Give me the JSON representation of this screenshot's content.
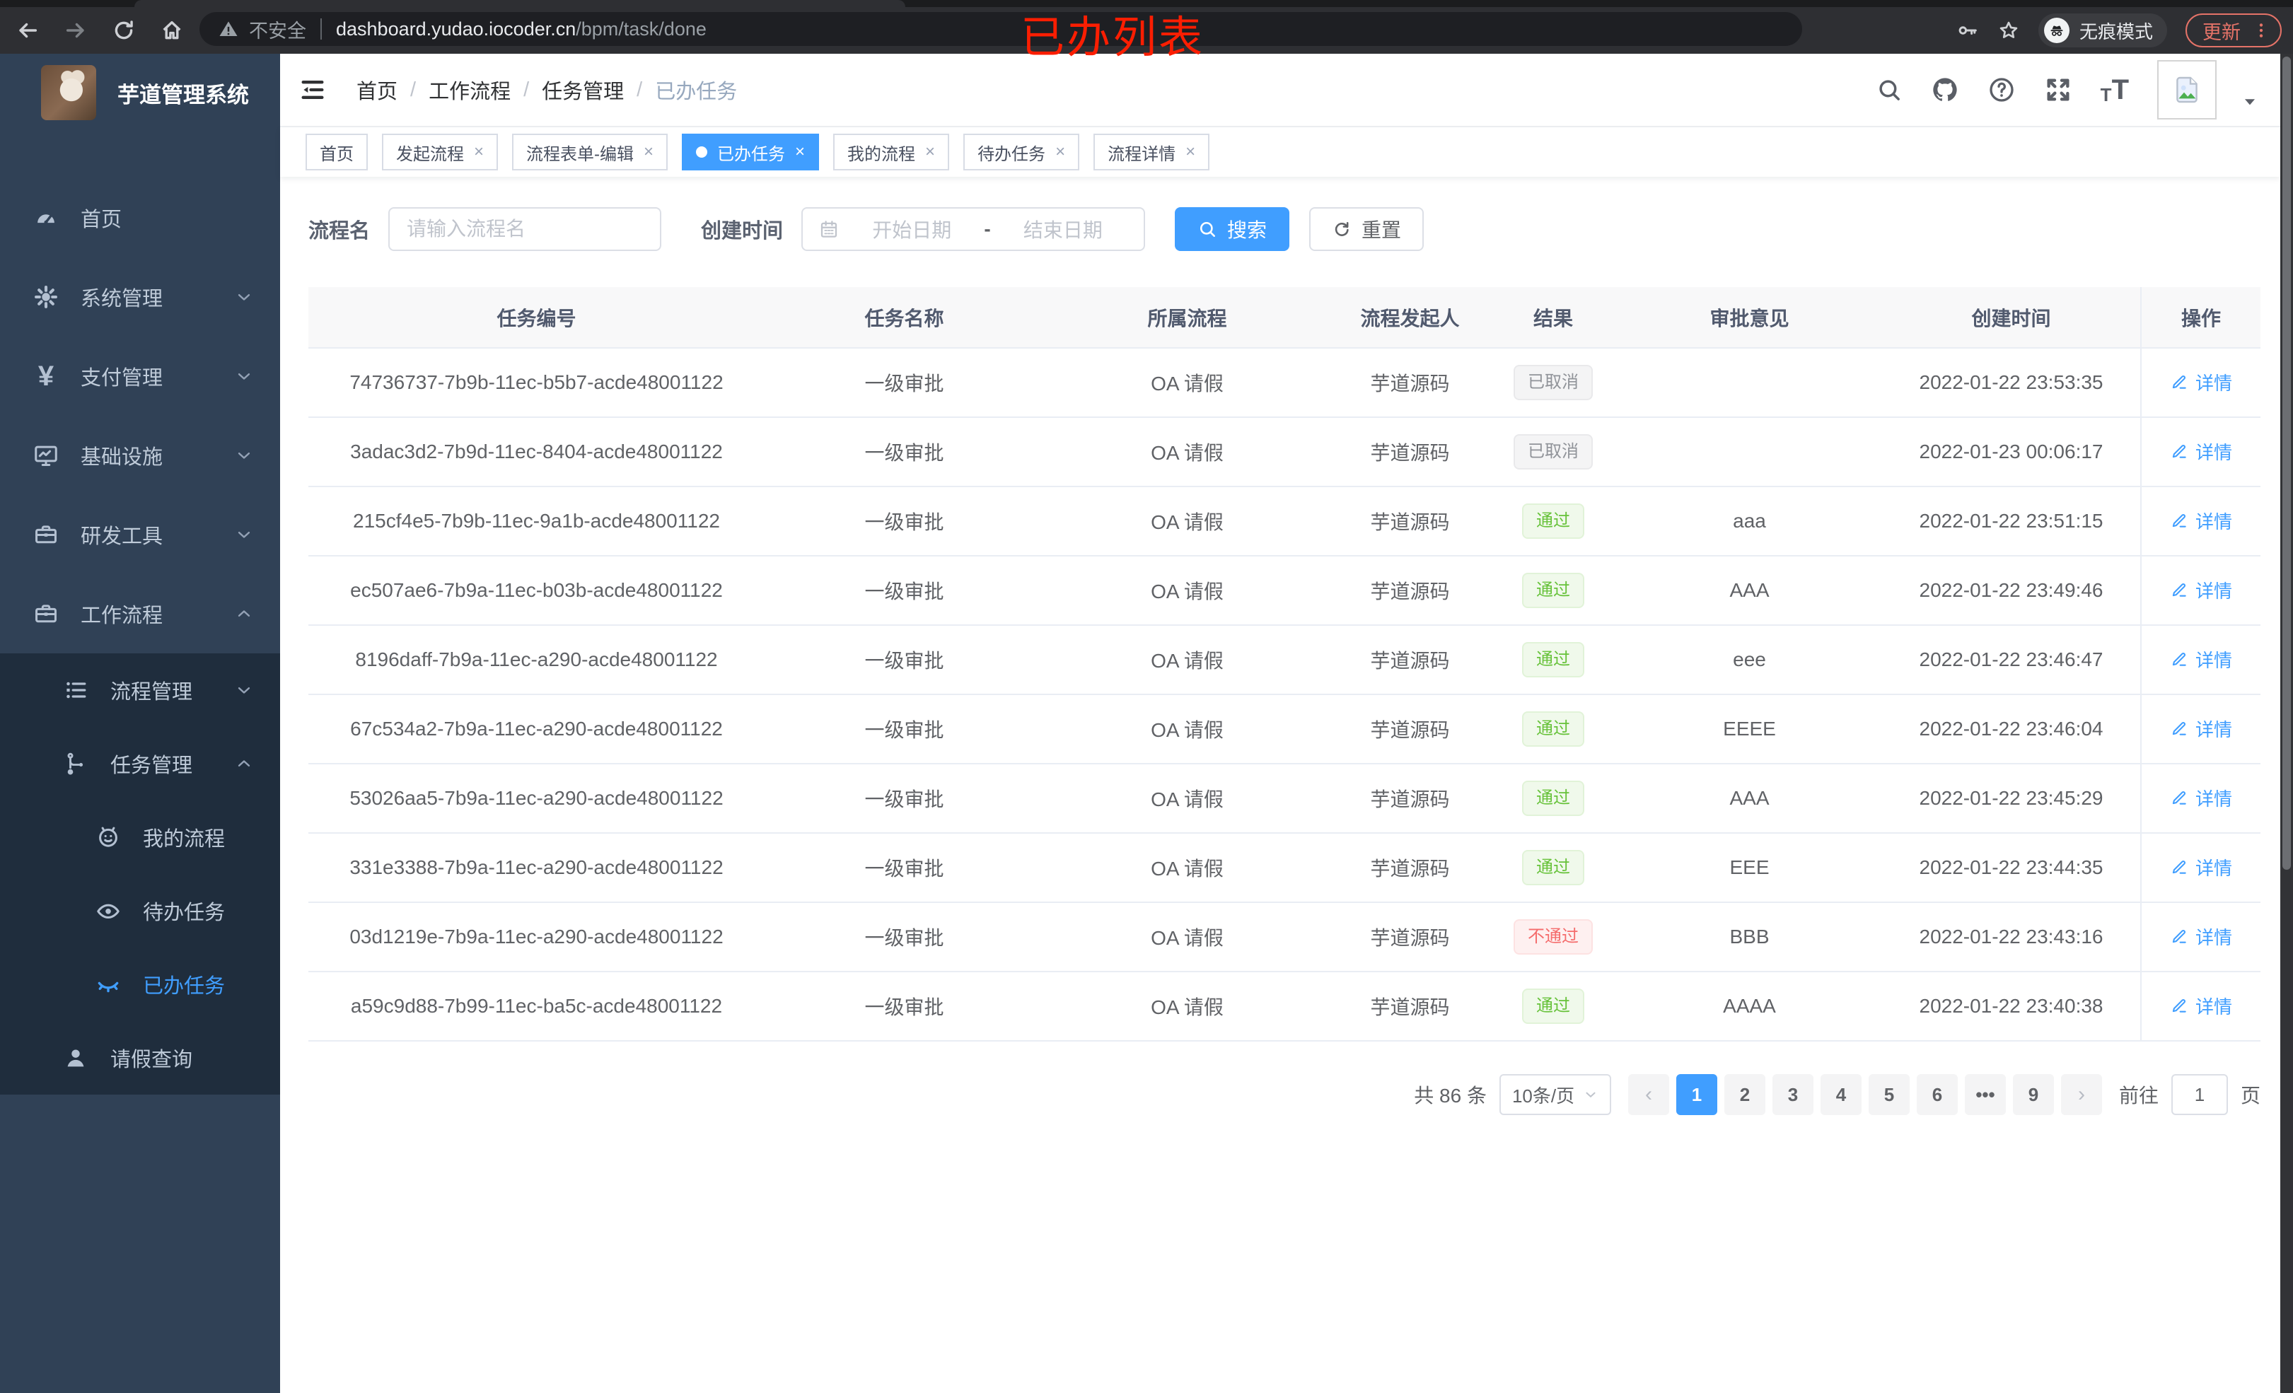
{
  "browser": {
    "security_label": "不安全",
    "url_host": "dashboard.yudao.iocoder.cn",
    "url_path": "/bpm/task/done",
    "incognito_label": "无痕模式",
    "update_label": "更新"
  },
  "annotation": "已办列表",
  "sidebar": {
    "title": "芋道管理系统",
    "items": [
      {
        "label": "首页",
        "icon": "dashboard-icon",
        "level": 1,
        "chevron": "",
        "group": false,
        "active": false
      },
      {
        "label": "系统管理",
        "icon": "gear-icon",
        "level": 1,
        "chevron": "down",
        "group": false,
        "active": false
      },
      {
        "label": "支付管理",
        "icon": "yen-icon",
        "level": 1,
        "chevron": "down",
        "group": false,
        "active": false
      },
      {
        "label": "基础设施",
        "icon": "monitor-icon",
        "level": 1,
        "chevron": "down",
        "group": false,
        "active": false
      },
      {
        "label": "研发工具",
        "icon": "toolbox-icon",
        "level": 1,
        "chevron": "down",
        "group": false,
        "active": false
      },
      {
        "label": "工作流程",
        "icon": "briefcase-icon",
        "level": 1,
        "chevron": "up",
        "group": false,
        "active": false
      },
      {
        "label": "流程管理",
        "icon": "list-icon",
        "level": 2,
        "chevron": "down",
        "group": true,
        "active": false
      },
      {
        "label": "任务管理",
        "icon": "flow-icon",
        "level": 2,
        "chevron": "up",
        "group": true,
        "active": false
      },
      {
        "label": "我的流程",
        "icon": "face-icon",
        "level": 3,
        "chevron": "",
        "group": true,
        "active": false
      },
      {
        "label": "待办任务",
        "icon": "eye-icon",
        "level": 3,
        "chevron": "",
        "group": true,
        "active": false
      },
      {
        "label": "已办任务",
        "icon": "eye-off-icon",
        "level": 3,
        "chevron": "",
        "group": true,
        "active": true
      },
      {
        "label": "请假查询",
        "icon": "user-icon",
        "level": 2,
        "chevron": "",
        "group": true,
        "active": false
      }
    ]
  },
  "navbar": {
    "breadcrumb": [
      "首页",
      "工作流程",
      "任务管理",
      "已办任务"
    ],
    "icons": [
      "search-icon",
      "github-icon",
      "help-icon",
      "fullscreen-icon",
      "text-size-icon"
    ]
  },
  "tabs": [
    {
      "label": "首页",
      "closable": false,
      "active": false
    },
    {
      "label": "发起流程",
      "closable": true,
      "active": false
    },
    {
      "label": "流程表单-编辑",
      "closable": true,
      "active": false
    },
    {
      "label": "已办任务",
      "closable": true,
      "active": true
    },
    {
      "label": "我的流程",
      "closable": true,
      "active": false
    },
    {
      "label": "待办任务",
      "closable": true,
      "active": false
    },
    {
      "label": "流程详情",
      "closable": true,
      "active": false
    }
  ],
  "filters": {
    "name_label": "流程名",
    "name_placeholder": "请输入流程名",
    "time_label": "创建时间",
    "start_placeholder": "开始日期",
    "range_separator": "-",
    "end_placeholder": "结束日期",
    "search_label": "搜索",
    "reset_label": "重置"
  },
  "table": {
    "columns": [
      "任务编号",
      "任务名称",
      "所属流程",
      "流程发起人",
      "结果",
      "审批意见",
      "创建时间",
      "操作"
    ],
    "detail_label": "详情",
    "rows": [
      {
        "id": "74736737-7b9b-11ec-b5b7-acde48001122",
        "name": "一级审批",
        "process": "OA 请假",
        "starter": "芋道源码",
        "result": "已取消",
        "result_type": "info",
        "comment": "",
        "created": "2022-01-22 23:53:35"
      },
      {
        "id": "3adac3d2-7b9d-11ec-8404-acde48001122",
        "name": "一级审批",
        "process": "OA 请假",
        "starter": "芋道源码",
        "result": "已取消",
        "result_type": "info",
        "comment": "",
        "created": "2022-01-23 00:06:17"
      },
      {
        "id": "215cf4e5-7b9b-11ec-9a1b-acde48001122",
        "name": "一级审批",
        "process": "OA 请假",
        "starter": "芋道源码",
        "result": "通过",
        "result_type": "success",
        "comment": "aaa",
        "created": "2022-01-22 23:51:15"
      },
      {
        "id": "ec507ae6-7b9a-11ec-b03b-acde48001122",
        "name": "一级审批",
        "process": "OA 请假",
        "starter": "芋道源码",
        "result": "通过",
        "result_type": "success",
        "comment": "AAA",
        "created": "2022-01-22 23:49:46"
      },
      {
        "id": "8196daff-7b9a-11ec-a290-acde48001122",
        "name": "一级审批",
        "process": "OA 请假",
        "starter": "芋道源码",
        "result": "通过",
        "result_type": "success",
        "comment": "eee",
        "created": "2022-01-22 23:46:47"
      },
      {
        "id": "67c534a2-7b9a-11ec-a290-acde48001122",
        "name": "一级审批",
        "process": "OA 请假",
        "starter": "芋道源码",
        "result": "通过",
        "result_type": "success",
        "comment": "EEEE",
        "created": "2022-01-22 23:46:04"
      },
      {
        "id": "53026aa5-7b9a-11ec-a290-acde48001122",
        "name": "一级审批",
        "process": "OA 请假",
        "starter": "芋道源码",
        "result": "通过",
        "result_type": "success",
        "comment": "AAA",
        "created": "2022-01-22 23:45:29"
      },
      {
        "id": "331e3388-7b9a-11ec-a290-acde48001122",
        "name": "一级审批",
        "process": "OA 请假",
        "starter": "芋道源码",
        "result": "通过",
        "result_type": "success",
        "comment": "EEE",
        "created": "2022-01-22 23:44:35"
      },
      {
        "id": "03d1219e-7b9a-11ec-a290-acde48001122",
        "name": "一级审批",
        "process": "OA 请假",
        "starter": "芋道源码",
        "result": "不通过",
        "result_type": "danger",
        "comment": "BBB",
        "created": "2022-01-22 23:43:16"
      },
      {
        "id": "a59c9d88-7b99-11ec-ba5c-acde48001122",
        "name": "一级审批",
        "process": "OA 请假",
        "starter": "芋道源码",
        "result": "通过",
        "result_type": "success",
        "comment": "AAAA",
        "created": "2022-01-22 23:40:38"
      }
    ]
  },
  "pagination": {
    "total_label": "共 86 条",
    "page_size": "10条/页",
    "pages": [
      "1",
      "2",
      "3",
      "4",
      "5",
      "6",
      "•••",
      "9"
    ],
    "active_page": "1",
    "goto_label": "前往",
    "goto_value": "1",
    "page_unit": "页"
  },
  "colors": {
    "primary": "#409eff",
    "success": "#67c23a",
    "danger": "#f56c6c",
    "info": "#909399",
    "sidebar": "#304156",
    "submenu": "#1f2d3d"
  }
}
